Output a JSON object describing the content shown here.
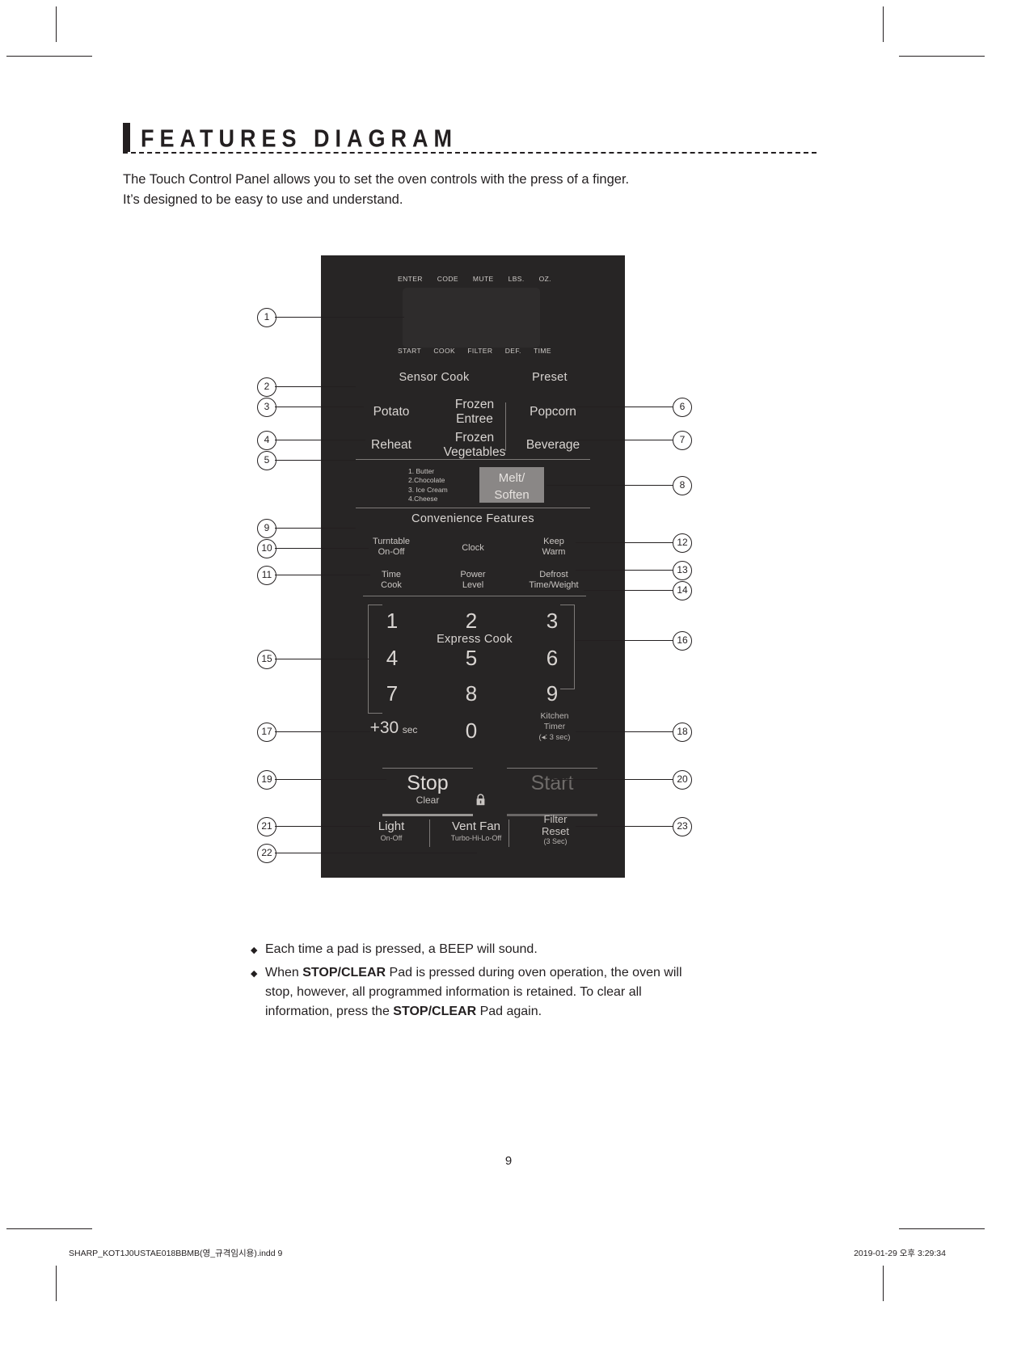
{
  "header": {
    "title": "FEATURES DIAGRAM"
  },
  "intro": {
    "line1": "The Touch Control Panel allows you to set the oven controls with the press of a finger.",
    "line2": "It’s designed to be easy to use and understand."
  },
  "panel": {
    "display_top": [
      "ENTER",
      "CODE",
      "MUTE",
      "LBS.",
      "OZ."
    ],
    "display_bottom": [
      "START",
      "COOK",
      "FILTER",
      "DEF.",
      "TIME"
    ],
    "sections": {
      "sensor_cook": "Sensor Cook",
      "preset": "Preset",
      "convenience": "Convenience Features",
      "express_cook": "Express Cook"
    },
    "pads": {
      "potato": "Potato",
      "frozen_entree_1": "Frozen",
      "frozen_entree_2": "Entree",
      "reheat": "Reheat",
      "frozen_veg_1": "Frozen",
      "frozen_veg_2": "Vegetables",
      "popcorn": "Popcorn",
      "beverage": "Beverage",
      "melt_soften_1": "Melt/",
      "melt_soften_2": "Soften",
      "turntable_1": "Turntable",
      "turntable_2": "On-Off",
      "clock": "Clock",
      "keep_warm_1": "Keep",
      "keep_warm_2": "Warm",
      "time_cook_1": "Time",
      "time_cook_2": "Cook",
      "power_level_1": "Power",
      "power_level_2": "Level",
      "defrost_1": "Defrost",
      "defrost_2": "Time/Weight",
      "add30_main": "+30",
      "add30_sub": "sec",
      "kitchen_timer_1": "Kitchen",
      "kitchen_timer_2": "Timer",
      "kitchen_timer_3": "(◂∶ 3 sec)",
      "stop": "Stop",
      "clear": "Clear",
      "start": "Start",
      "light_1": "Light",
      "light_2": "On-Off",
      "vent_fan_1": "Vent Fan",
      "vent_fan_2": "Turbo-Hi-Lo-Off",
      "filter_1": "Filter",
      "filter_2": "Reset",
      "filter_3": "(3 Sec)"
    },
    "melt_list": [
      "1. Butter",
      "2.Chocolate",
      "3. Ice Cream",
      "4.Cheese"
    ],
    "digits": [
      "1",
      "2",
      "3",
      "4",
      "5",
      "6",
      "7",
      "8",
      "9",
      "0"
    ],
    "callouts_left": [
      "1",
      "2",
      "3",
      "4",
      "5",
      "9",
      "10",
      "11",
      "15",
      "17",
      "19",
      "21",
      "22"
    ],
    "callouts_right": [
      "6",
      "7",
      "8",
      "12",
      "13",
      "14",
      "16",
      "18",
      "20",
      "23"
    ]
  },
  "notes": {
    "n1_text": "Each time a pad is pressed, a BEEP will sound.",
    "n2_a": "When ",
    "n2_b": "STOP/CLEAR",
    "n2_c": " Pad is pressed during oven operation, the oven will stop, however, all programmed information is retained. To clear all information, press the ",
    "n2_d": "STOP/CLEAR",
    "n2_e": " Pad again.",
    "bullet_glyph": "◆"
  },
  "folio": "9",
  "footer": {
    "left": "SHARP_KOT1J0USTAE018BBMB(영_규격임시용).indd   9",
    "right": "2019-01-29   오후 3:29:34"
  },
  "colors": {
    "ink": "#231f20",
    "panel_bg": "#272525",
    "pad_text": "#d9d5d2",
    "melt_fill": "#8a8786"
  }
}
